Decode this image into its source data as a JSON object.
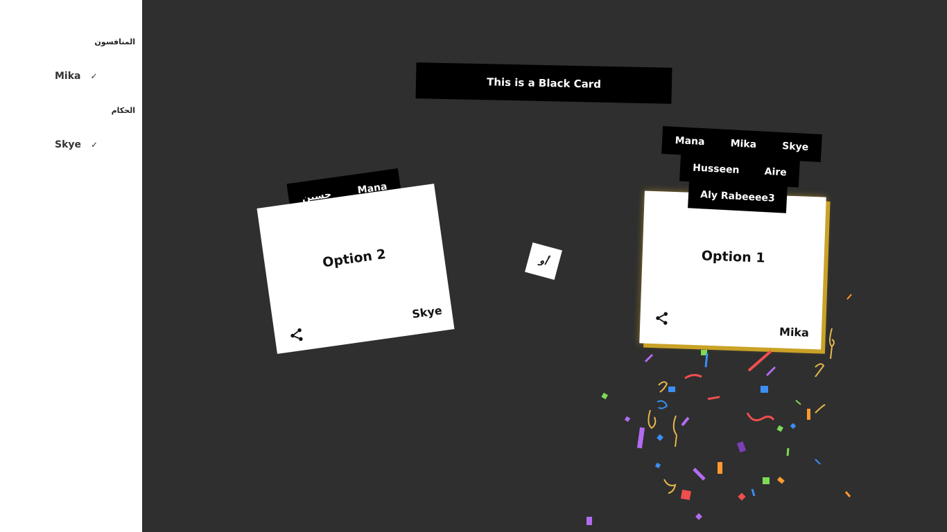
{
  "sidebar": {
    "contestants_heading": "المنافسون",
    "contestants": [
      {
        "name": "Mika"
      }
    ],
    "judges_heading": "الحكام",
    "judges": [
      {
        "name": "Skye"
      }
    ]
  },
  "black_card": {
    "text": "This is a Black Card"
  },
  "or_label": "أو",
  "cards": {
    "left": {
      "option": "Option 2",
      "author": "Skye",
      "voters": [
        "حسين",
        "Mana"
      ]
    },
    "right": {
      "option": "Option 1",
      "author": "Mika",
      "voters_row1": [
        "Mana",
        "Mika",
        "Skye"
      ],
      "voters_row2": [
        "Husseen",
        "Aire"
      ],
      "voters_row3": [
        "Aly Rabeeee3"
      ],
      "highlight_color": "#c9a227"
    }
  },
  "icons": {
    "check": "check-icon",
    "share": "share-icon"
  },
  "colors": {
    "background": "#2f2f2f",
    "sidebar": "#ffffff",
    "card": "#ffffff",
    "black_card": "#000000"
  }
}
